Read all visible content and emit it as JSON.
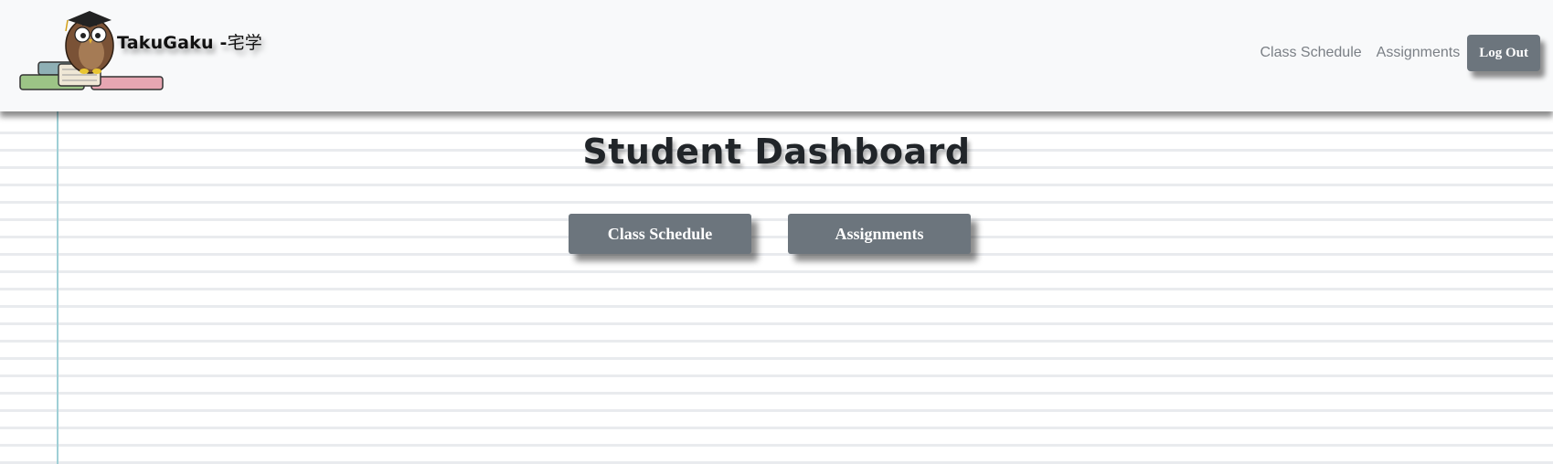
{
  "navbar": {
    "brand_name": "TakuGaku -",
    "brand_kanji": "宅学",
    "logo_icon": "owl-on-books-icon",
    "links": [
      {
        "label": "Class Schedule"
      },
      {
        "label": "Assignments"
      }
    ],
    "logout_label": "Log Out"
  },
  "main": {
    "title": "Student Dashboard",
    "buttons": [
      {
        "label": "Class Schedule"
      },
      {
        "label": "Assignments"
      }
    ]
  },
  "colors": {
    "navbar_bg": "#f8f9fa",
    "button_bg": "#6c757d",
    "nav_link": "#7a7f85",
    "margin_line": "#9fcfd6",
    "ruled_line": "#e9ebee"
  }
}
